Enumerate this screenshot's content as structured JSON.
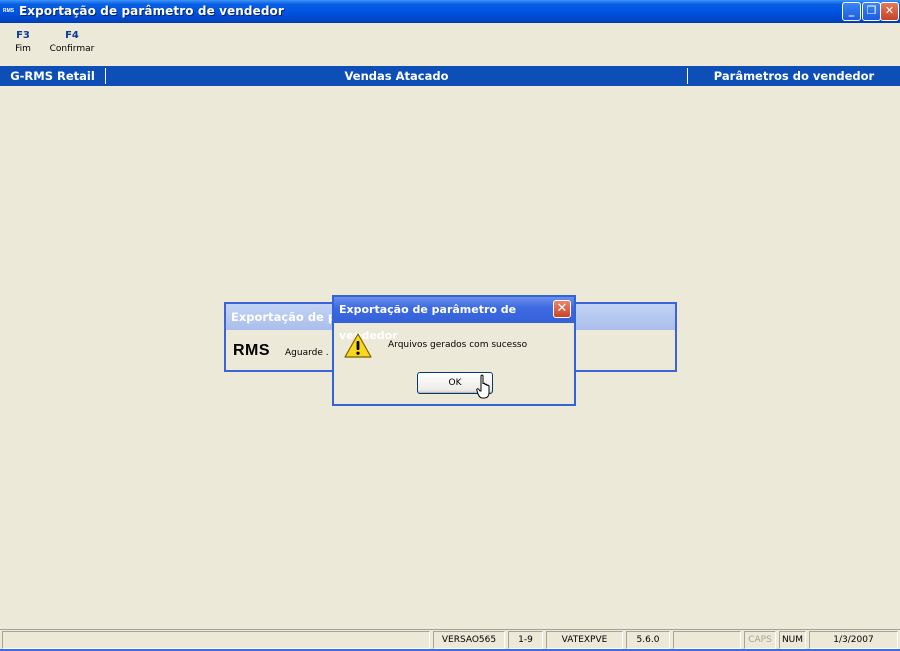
{
  "window": {
    "app_icon_text": "RMS",
    "title": "Exportação de parâmetro de vendedor",
    "min_glyph": "_",
    "max_glyph": "❐",
    "close_glyph": "✕"
  },
  "toolbar": {
    "keys": [
      {
        "key": "F3",
        "label": "Fim"
      },
      {
        "key": "F4",
        "label": "Confirmar"
      }
    ]
  },
  "header": {
    "left": "G-RMS Retail",
    "center": "Vendas Atacado",
    "right": "Parâmetros do vendedor"
  },
  "wait_dialog": {
    "title": "Exportação de parâ",
    "logo": "RMS",
    "message": "Aguarde . C"
  },
  "message_dialog": {
    "title": "Exportação de parâmetro de vendedor",
    "close_glyph": "✕",
    "message": "Arquivos gerados com sucesso",
    "ok_label": "OK",
    "icon": "warning-icon"
  },
  "statusbar": {
    "panels": [
      "",
      "VERSAO565",
      "1-9",
      "VATEXPVE",
      "5.6.0",
      "",
      "CAPS",
      "NUM",
      "1/3/2007"
    ]
  },
  "colors": {
    "titlebar": "#0054E3",
    "header_strip": "#0E4FB7",
    "background": "#ECE9D8",
    "dialog_border": "#3165D6"
  }
}
